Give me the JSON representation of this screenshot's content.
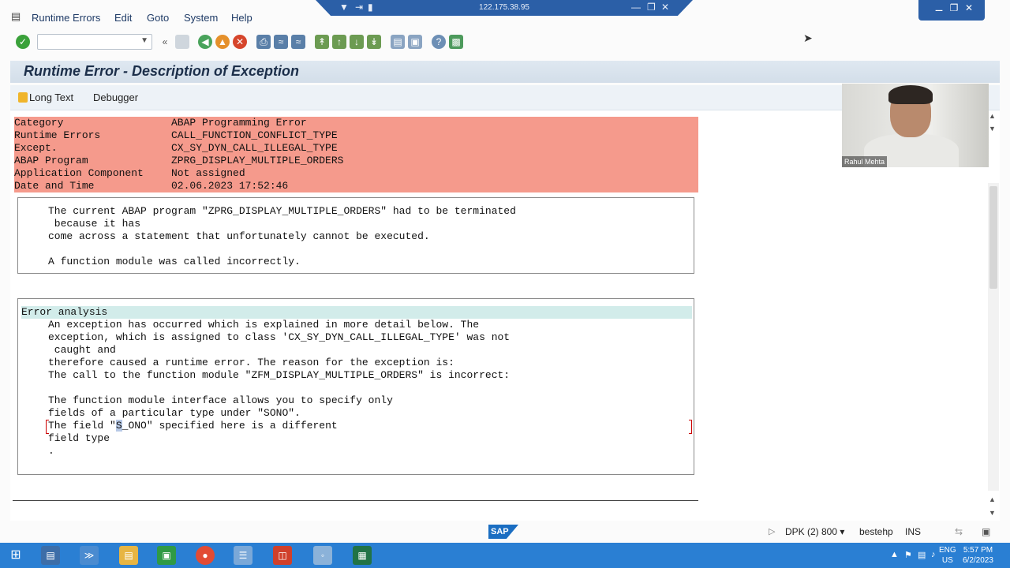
{
  "remote_bar": {
    "ip": "122.175.38.95"
  },
  "menu": {
    "items": [
      "Runtime Errors",
      "Edit",
      "Goto",
      "System",
      "Help"
    ]
  },
  "toolbar": {
    "command_field_value": ""
  },
  "title": "Runtime Error - Description of Exception",
  "app_toolbar": {
    "long_text": "Long Text",
    "debugger": "Debugger"
  },
  "info": [
    {
      "key": "Category",
      "value": "ABAP Programming Error"
    },
    {
      "key": "Runtime Errors",
      "value": "CALL_FUNCTION_CONFLICT_TYPE"
    },
    {
      "key": "Except.",
      "value": "CX_SY_DYN_CALL_ILLEGAL_TYPE"
    },
    {
      "key": "ABAP Program",
      "value": "ZPRG_DISPLAY_MULTIPLE_ORDERS"
    },
    {
      "key": "Application Component",
      "value": "Not assigned"
    },
    {
      "key": "Date and Time",
      "value": "02.06.2023 17:52:46"
    }
  ],
  "short_text": {
    "lines": [
      "The current ABAP program \"ZPRG_DISPLAY_MULTIPLE_ORDERS\" had to be terminated",
      " because it has",
      "come across a statement that unfortunately cannot be executed.",
      "",
      "A function module was called incorrectly."
    ]
  },
  "error_analysis": {
    "heading": "Error analysis",
    "lines": [
      "An exception has occurred which is explained in more detail below. The",
      "exception, which is assigned to class 'CX_SY_DYN_CALL_ILLEGAL_TYPE' was not",
      " caught and",
      "therefore caused a runtime error. The reason for the exception is:",
      "The call to the function module \"ZFM_DISPLAY_MULTIPLE_ORDERS\" is incorrect:",
      "",
      "The function module interface allows you to specify only",
      "fields of a particular type under \"SONO\".",
      "The field \"S_ONO\" specified here is a different",
      "field type",
      "."
    ],
    "highlight_line": {
      "before": "The field \"",
      "selected": "S",
      "after": "_ONO\" specified here is a different"
    }
  },
  "webcam": {
    "name": "Rahul Mehta"
  },
  "status": {
    "system": "DPK (2) 800",
    "user": "bestehp",
    "mode": "INS",
    "logo": "SAP"
  },
  "taskbar": {
    "lang_top": "ENG",
    "lang_bottom": "US",
    "time": "5:57 PM",
    "date": "6/2/2023"
  },
  "colors": {
    "error_bg": "#f59a8c",
    "header_bg": "#d2ecea",
    "taskbar": "#2a7fd3",
    "remote_bar": "#2b5fa7"
  }
}
